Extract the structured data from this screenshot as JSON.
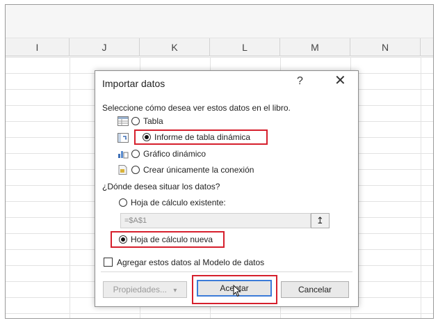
{
  "spreadsheet": {
    "columns": [
      "I",
      "J",
      "K",
      "L",
      "M",
      "N"
    ]
  },
  "dialog": {
    "title": "Importar datos",
    "help": "?",
    "close": "✕",
    "view_prompt": "Seleccione cómo desea ver estos datos en el libro.",
    "view_options": [
      {
        "label": "Tabla",
        "icon": "table-icon",
        "selected": false
      },
      {
        "label": "Informe de tabla dinámica",
        "icon": "pivot-table-icon",
        "selected": true
      },
      {
        "label": "Gráfico dinámico",
        "icon": "pivot-chart-icon",
        "selected": false
      },
      {
        "label": "Crear únicamente la conexión",
        "icon": "connection-icon",
        "selected": false
      }
    ],
    "location_prompt": "¿Dónde desea situar los datos?",
    "location_options": [
      {
        "label": "Hoja de cálculo existente:",
        "selected": false
      },
      {
        "label": "Hoja de cálculo nueva",
        "selected": true
      }
    ],
    "cell_reference": "=$A$1",
    "collapse_button": "↥",
    "data_model_checkbox": {
      "label": "Agregar estos datos al Modelo de datos",
      "checked": false
    },
    "buttons": {
      "properties": "Propiedades...",
      "properties_arrow": "▾",
      "accept": "Aceptar",
      "cancel": "Cancelar"
    },
    "highlight_color": "#d61f2c"
  }
}
